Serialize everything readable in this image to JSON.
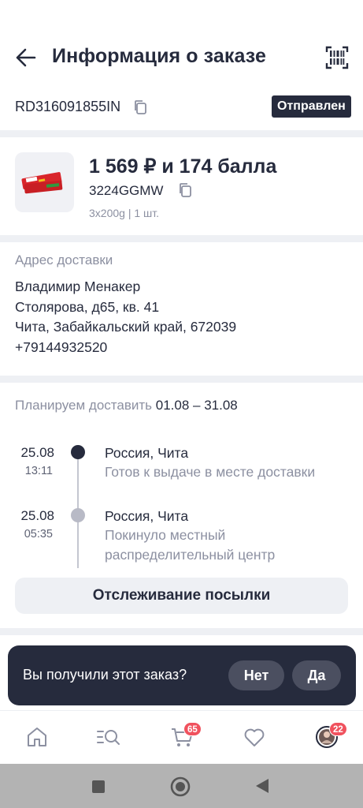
{
  "header": {
    "title": "Информация о заказе"
  },
  "order": {
    "track_number": "RD316091855IN",
    "status": "Отправлен"
  },
  "product": {
    "price": "1 569 ₽ и 174 балла",
    "sku": "3224GGMW",
    "variant": "3x200g | 1 шт."
  },
  "address": {
    "label": "Адрес доставки",
    "name": "Владимир Менакер",
    "street": "Столярова, д65, кв. 41",
    "city": "Чита, Забайкальский край, 672039",
    "phone": "+79144932520"
  },
  "delivery": {
    "plan_label": "Планируем доставить",
    "plan_dates": "01.08 – 31.08"
  },
  "tracking_events": [
    {
      "date": "25.08",
      "time": "13:11",
      "place": "Россия, Чита",
      "description": "Готов к выдаче в месте доставки"
    },
    {
      "date": "25.08",
      "time": "05:35",
      "place": "Россия, Чита",
      "description": "Покинуло местный распределительный центр"
    }
  ],
  "track_button": "Отслеживание посылки",
  "snackbar": {
    "question": "Вы получили этот заказ?",
    "no": "Нет",
    "yes": "Да"
  },
  "nav": {
    "cart_count": "65",
    "profile_count": "22"
  },
  "colors": {
    "dark": "#262b3d",
    "muted": "#8c90a1",
    "badge": "#f0525e",
    "surface": "#eef0f4"
  }
}
